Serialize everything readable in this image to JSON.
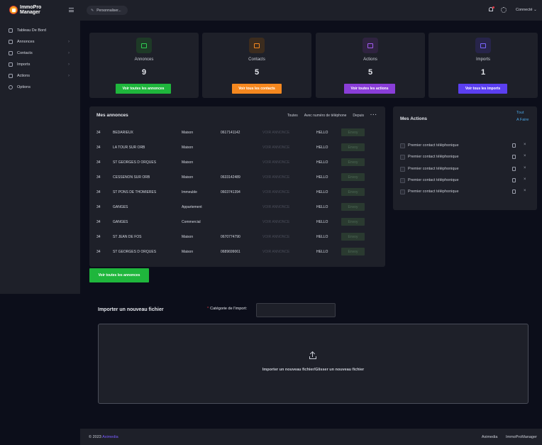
{
  "app": {
    "logo_line1": "ImmoPro",
    "logo_line2": "Manager"
  },
  "sidebar": {
    "items": [
      {
        "label": "Tableau De Bord",
        "icon": "dashboard-icon",
        "has_children": false
      },
      {
        "label": "Annonces",
        "icon": "listing-icon",
        "has_children": true
      },
      {
        "label": "Contacts",
        "icon": "contacts-icon",
        "has_children": true
      },
      {
        "label": "Imports",
        "icon": "import-icon",
        "has_children": true
      },
      {
        "label": "Actions",
        "icon": "actions-icon",
        "has_children": true
      },
      {
        "label": "Options",
        "icon": "gear-icon",
        "has_children": false
      }
    ]
  },
  "header": {
    "customize_label": "Personnaliser...",
    "user_label": "Connecté"
  },
  "stats": [
    {
      "label": "Annonces",
      "value": "9",
      "button": "Voir toutes les annonces",
      "color": "#1fb63c",
      "icon_bg": "#1e3a27",
      "icon_color": "#2fcf52",
      "icon": "house-icon"
    },
    {
      "label": "Contacts",
      "value": "5",
      "button": "Voir tous les contacts",
      "color": "#f5881f",
      "icon_bg": "#3c2c1e",
      "icon_color": "#f5881f",
      "icon": "contact-card-icon"
    },
    {
      "label": "Actions",
      "value": "5",
      "button": "Voir toutes les actions",
      "color": "#8a3ed8",
      "icon_bg": "#2f2340",
      "icon_color": "#a35cf0",
      "icon": "actions-icon"
    },
    {
      "label": "Imports",
      "value": "1",
      "button": "Voir tous les imports",
      "color": "#5b3ff0",
      "icon_bg": "#27244a",
      "icon_color": "#7a66ff",
      "icon": "document-icon"
    }
  ],
  "annonces": {
    "title": "Mes annonces",
    "filters": [
      "Toutes",
      "Avec numéro de téléphone",
      "Depuis"
    ],
    "link_label": "VOIR ANNONCE",
    "rows": [
      {
        "dep": "34",
        "city": "BEDARIEUX",
        "type": "Maison",
        "phone": "0617141142",
        "hello": "HELLO",
        "status": "Envoy"
      },
      {
        "dep": "34",
        "city": "LA TOUR SUR ORB",
        "type": "Maison",
        "phone": "",
        "hello": "HELLO",
        "status": "Envoy"
      },
      {
        "dep": "34",
        "city": "ST GEORGES D ORQUES",
        "type": "Maison",
        "phone": "",
        "hello": "HELLO",
        "status": "Envoy"
      },
      {
        "dep": "34",
        "city": "CESSENON SUR ORB",
        "type": "Maison",
        "phone": "0633142489",
        "hello": "HELLO",
        "status": "Envoy"
      },
      {
        "dep": "34",
        "city": "ST PONS DE THOMIERES",
        "type": "Immeuble",
        "phone": "0603741394",
        "hello": "HELLO",
        "status": "Envoy"
      },
      {
        "dep": "34",
        "city": "GANGES",
        "type": "Appartement",
        "phone": "",
        "hello": "HELLO",
        "status": "Envoy"
      },
      {
        "dep": "34",
        "city": "GANGES",
        "type": "Commercial",
        "phone": "",
        "hello": "HELLO",
        "status": "Envoy"
      },
      {
        "dep": "34",
        "city": "ST JEAN DE FOS",
        "type": "Maison",
        "phone": "0670774790",
        "hello": "HELLO",
        "status": "Envoy"
      },
      {
        "dep": "34",
        "city": "ST GEORGES D ORQUES",
        "type": "Maison",
        "phone": "0689699061",
        "hello": "HELLO",
        "status": "Envoy"
      }
    ],
    "all_button": "Voir toutes les annonces"
  },
  "actions": {
    "title": "Mes Actions",
    "filter_all": "Tout",
    "filter_todo": "A Faire",
    "items": [
      "Premier contact téléphonique",
      "Premier contact téléphonique",
      "Premier contact téléphonique",
      "Premier contact téléphonique",
      "Premier contact téléphonique"
    ]
  },
  "import": {
    "title": "Importer un nouveau fichier",
    "category_label": "Catégorie de l'import:",
    "category_required": "*",
    "drop_text": "Importer un nouveau fichier/Glisser un nouveau fichier"
  },
  "footer": {
    "copyright_prefix": "© 2023",
    "brand": "Aximedia",
    "links": [
      "Aximedia",
      "ImmoProManager"
    ]
  }
}
